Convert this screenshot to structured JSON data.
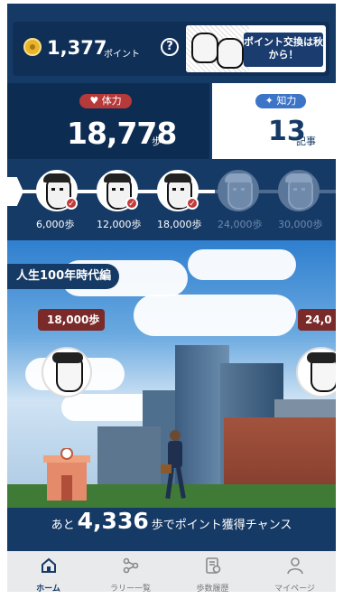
{
  "header": {
    "points": "1,377",
    "points_unit": "ポイント",
    "help_label": "?",
    "banner_text": "ポイント交換は秋から！"
  },
  "stats": {
    "stamina_label": "体力",
    "steps": "18,778",
    "steps_unit": "歩",
    "knowledge_label": "知力",
    "articles": "13",
    "articles_unit": "記事"
  },
  "milestones": [
    {
      "label": "6,000歩",
      "achieved": true
    },
    {
      "label": "12,000歩",
      "achieved": true
    },
    {
      "label": "18,000歩",
      "achieved": true
    },
    {
      "label": "24,000歩",
      "achieved": false
    },
    {
      "label": "30,000歩",
      "achieved": false
    }
  ],
  "scene": {
    "chapter": "人生100年時代編",
    "sign_current": "18,000歩",
    "sign_next": "24,0"
  },
  "cta": {
    "prefix": "あと",
    "remaining": "4,336",
    "suffix": "歩でポイント獲得チャンス"
  },
  "nav": {
    "items": [
      {
        "label": "ホーム",
        "icon": "home-icon",
        "active": true
      },
      {
        "label": "ラリー一覧",
        "icon": "rally-list-icon",
        "active": false
      },
      {
        "label": "歩数履歴",
        "icon": "step-history-icon",
        "active": false
      },
      {
        "label": "マイページ",
        "icon": "user-icon",
        "active": false
      }
    ]
  },
  "colors": {
    "brand_navy": "#163a66",
    "accent_red": "#b73a3a",
    "accent_blue": "#3c74c7",
    "coin_gold": "#e8b52a"
  }
}
